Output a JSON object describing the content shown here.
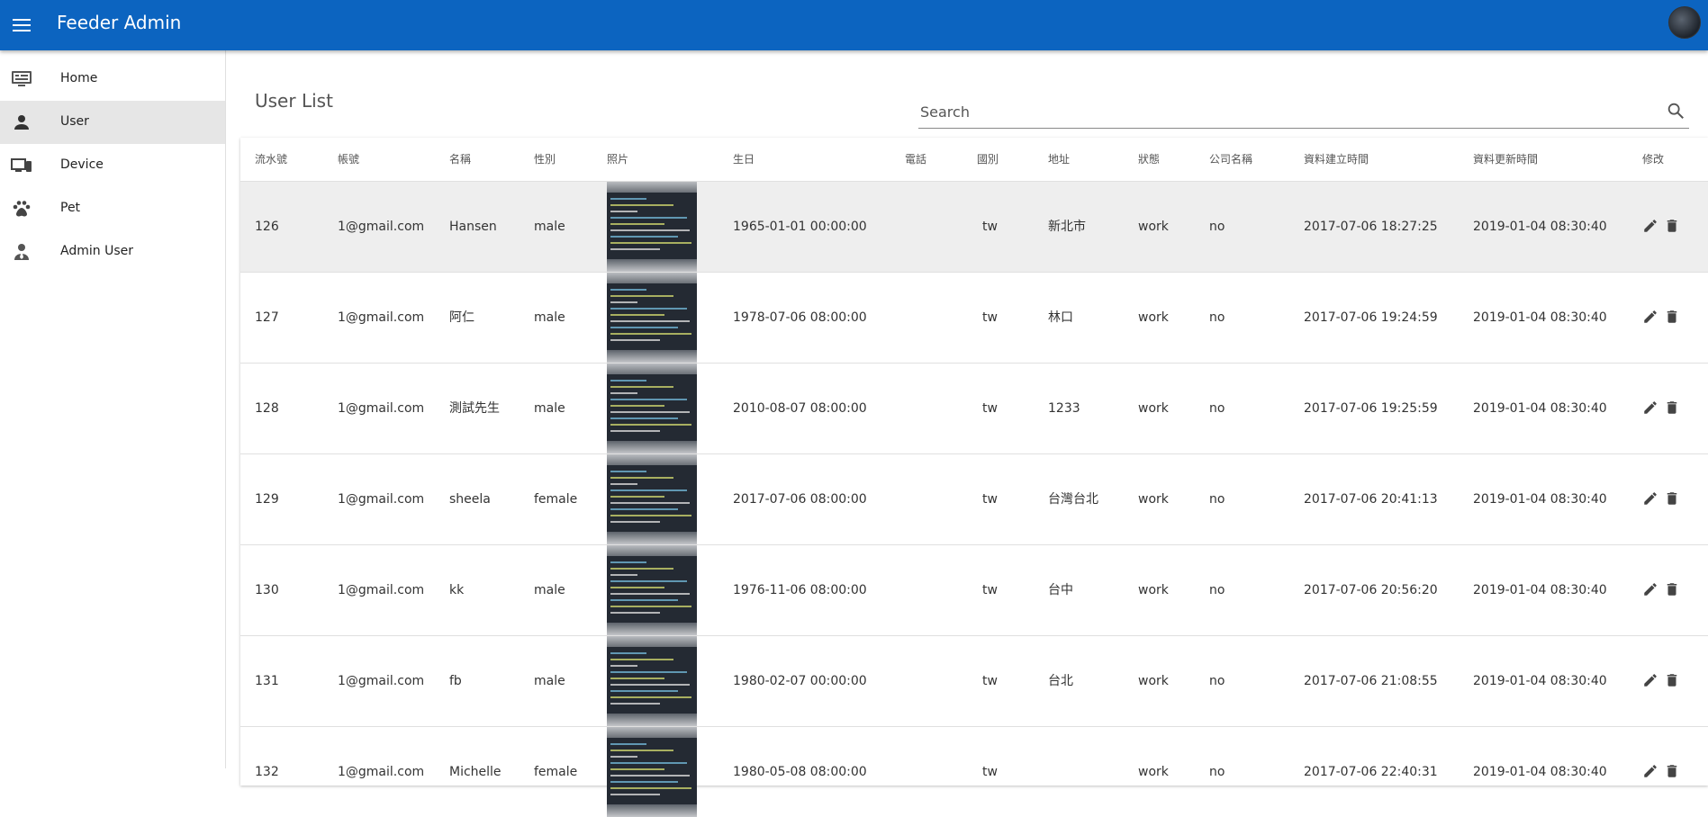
{
  "app": {
    "title": "Feeder Admin"
  },
  "colors": {
    "appbar": "#0c64c0",
    "active_nav": "#e6e6e6",
    "row_highlight": "#eeeeee"
  },
  "sidebar": {
    "items": [
      {
        "label": "Home",
        "icon": "monitor-icon"
      },
      {
        "label": "User",
        "icon": "person-icon",
        "active": true
      },
      {
        "label": "Device",
        "icon": "devices-icon"
      },
      {
        "label": "Pet",
        "icon": "paw-icon"
      },
      {
        "label": "Admin User",
        "icon": "admin-user-icon"
      }
    ]
  },
  "main": {
    "title": "User List",
    "search": {
      "placeholder": "Search",
      "value": ""
    }
  },
  "table": {
    "headers": [
      "流水號",
      "帳號",
      "名稱",
      "性別",
      "照片",
      "生日",
      "電話",
      "國別",
      "地址",
      "狀態",
      "公司名稱",
      "資料建立時間",
      "資料更新時間",
      "修改"
    ],
    "rows": [
      {
        "id": "126",
        "account": "1@gmail.com",
        "name": "Hansen",
        "gender": "male",
        "birthday": "1965-01-01 00:00:00",
        "phone": "",
        "country": "tw",
        "address": "新北市",
        "status": "work",
        "company": "no",
        "created": "2017-07-06 18:27:25",
        "updated": "2019-01-04 08:30:40"
      },
      {
        "id": "127",
        "account": "1@gmail.com",
        "name": "阿仁",
        "gender": "male",
        "birthday": "1978-07-06 08:00:00",
        "phone": "",
        "country": "tw",
        "address": "林口",
        "status": "work",
        "company": "no",
        "created": "2017-07-06 19:24:59",
        "updated": "2019-01-04 08:30:40"
      },
      {
        "id": "128",
        "account": "1@gmail.com",
        "name": "測試先生",
        "gender": "male",
        "birthday": "2010-08-07 08:00:00",
        "phone": "",
        "country": "tw",
        "address": "1233",
        "status": "work",
        "company": "no",
        "created": "2017-07-06 19:25:59",
        "updated": "2019-01-04 08:30:40"
      },
      {
        "id": "129",
        "account": "1@gmail.com",
        "name": "sheela",
        "gender": "female",
        "birthday": "2017-07-06 08:00:00",
        "phone": "",
        "country": "tw",
        "address": "台灣台北",
        "status": "work",
        "company": "no",
        "created": "2017-07-06 20:41:13",
        "updated": "2019-01-04 08:30:40"
      },
      {
        "id": "130",
        "account": "1@gmail.com",
        "name": "kk",
        "gender": "male",
        "birthday": "1976-11-06 08:00:00",
        "phone": "",
        "country": "tw",
        "address": "台中",
        "status": "work",
        "company": "no",
        "created": "2017-07-06 20:56:20",
        "updated": "2019-01-04 08:30:40"
      },
      {
        "id": "131",
        "account": "1@gmail.com",
        "name": "fb",
        "gender": "male",
        "birthday": "1980-02-07 00:00:00",
        "phone": "",
        "country": "tw",
        "address": "台北",
        "status": "work",
        "company": "no",
        "created": "2017-07-06 21:08:55",
        "updated": "2019-01-04 08:30:40"
      },
      {
        "id": "132",
        "account": "1@gmail.com",
        "name": "Michelle",
        "gender": "female",
        "birthday": "1980-05-08 08:00:00",
        "phone": "",
        "country": "tw",
        "address": "",
        "status": "work",
        "company": "no",
        "created": "2017-07-06 22:40:31",
        "updated": "2019-01-04 08:30:40"
      }
    ]
  }
}
